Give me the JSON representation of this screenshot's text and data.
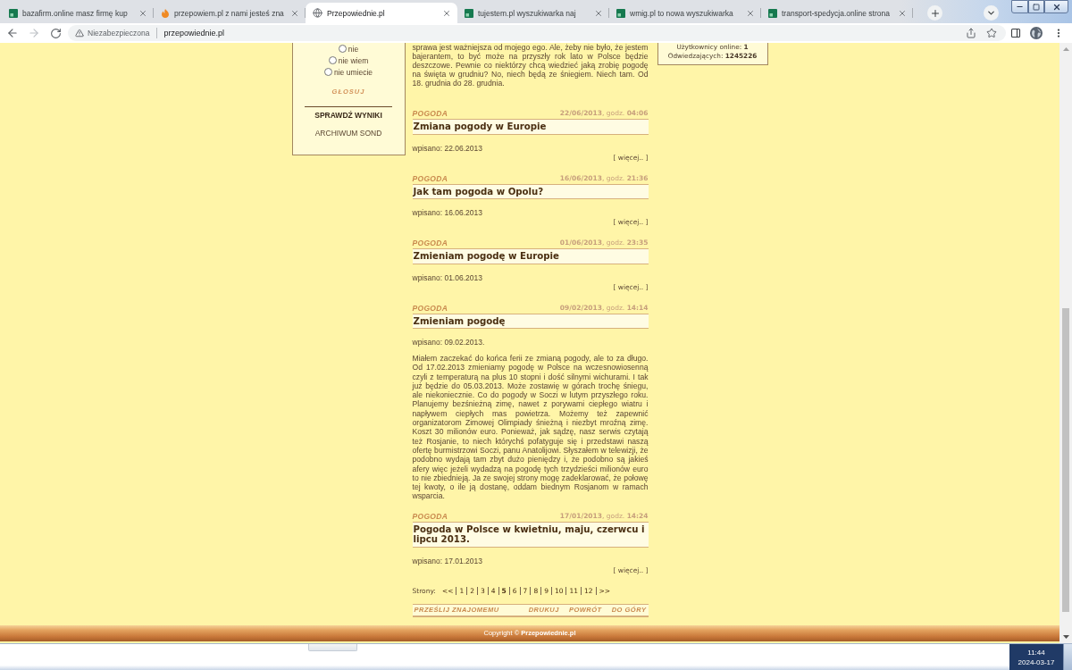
{
  "browser": {
    "tabs": [
      {
        "title": "bazafirm.online masz firmę kup",
        "kind": "tile",
        "selected": false
      },
      {
        "title": "przepowiem.pl z nami jesteś zna",
        "kind": "flame",
        "selected": false
      },
      {
        "title": "Przepowiednie.pl",
        "kind": "globe",
        "selected": true
      },
      {
        "title": "tujestem.pl wyszukiwarka naj",
        "kind": "tile",
        "selected": false
      },
      {
        "title": "wmig.pl to nowa wyszukiwarka",
        "kind": "tile",
        "selected": false
      },
      {
        "title": "transport-spedycja.online strona",
        "kind": "tile",
        "selected": false
      }
    ],
    "nav_buttons": [
      {
        "kind": "back",
        "disabled": false
      },
      {
        "kind": "forward",
        "disabled": true
      },
      {
        "kind": "reload",
        "disabled": false
      }
    ],
    "address_bar": {
      "security_label": "Niezabezpieczona",
      "url": "przepowiednie.pl"
    }
  },
  "page": {
    "poll": {
      "options": [
        {
          "label": "nie",
          "selected": false
        },
        {
          "label": "nie wiem",
          "selected": false
        },
        {
          "label": "nie umiecie",
          "selected": false
        }
      ],
      "vote_button": "GŁOSUJ",
      "results_link": "SPRAWDŹ WYNIKI",
      "archive_link": "ARCHIWUM SOND"
    },
    "intro_text": "sprawa jest ważniejsza od mojego ego. Ale, żeby nie było, że jestem bajerantem, to być może na przyszły rok lato w Polsce będzie deszczowe. Pewnie co niektórzy chcą wiedzieć jaką zrobię pogodę na święta w grudniu? No, niech będą ze śniegiem. Niech tam. Od 18. grudnia do 28. grudnia.",
    "stats": {
      "online": "Użytkownicy online: **1**",
      "visits": "Odwiedzających: **1245226**"
    },
    "articles": [
      {
        "category": "POGODA",
        "date": "**22/06/2013**, godz. **04:06**",
        "title": "Zmiana pogody w Europie",
        "posted": "wpisano: 22.06.2013",
        "more": "[ więcej.. ]"
      },
      {
        "category": "POGODA",
        "date": "**16/06/2013**, godz. **21:36**",
        "title": "Jak tam pogoda w Opolu?",
        "posted": "wpisano: 16.06.2013",
        "more": "[ więcej.. ]"
      },
      {
        "category": "POGODA",
        "date": "**01/06/2013**, godz. **23:35**",
        "title": "Zmieniam pogodę w Europie",
        "posted": "wpisano: 01.06.2013",
        "more": "[ więcej.. ]"
      },
      {
        "category": "POGODA",
        "date": "**09/02/2013**, godz. **14:14**",
        "title": "Zmieniam pogodę",
        "posted": "wpisano: 09.02.2013.",
        "body": "Miałem zaczekać do końca ferii ze zmianą pogody, ale to za długo. Od 17.02.2013 zmieniamy pogodę w Polsce na wczesnowiosenną czyli z temperaturą na plus 10 stopni i dość silnymi wichurami. I tak już będzie do 05.03.2013. Może zostawię w górach trochę śniegu, ale niekoniecznie. Co do pogody w Soczi w lutym przyszłego roku. Planujemy bezśnieżną zimę, nawet z porywami ciepłego wiatru i napływem ciepłych mas powietrza. Możemy też zapewnić organizatorom Zimowej Olimpiady śnieżną i niezbyt mroźną zimę. Koszt 30 milionów euro. Ponieważ, jak sądzę, nasz serwis czytają też Rosjanie, to niech którychś pofatyguje się i przedstawi naszą ofertę burmistrzowi Soczi, panu Anatolijowi. Słyszałem w telewizji, że podobno wydają tam zbyt dużo pieniędzy i, że podobno są jakieś afery więc jeżeli wydadzą na pogodę tych trzydzieści milionów euro to nie zbiednieją. Ja ze swojej strony mogę zadeklarować, że połowę tej kwoty, o ile ją dostanę, oddam biednym Rosjanom w ramach wsparcia."
      },
      {
        "category": "POGODA",
        "date": "**17/01/2013**, godz. **14:24**",
        "title": "Pogoda w Polsce w kwietniu, maju, czerwcu i lipcu 2013.",
        "posted": "wpisano: 17.01.2013",
        "more": "[ więcej.. ]"
      }
    ],
    "pagination": {
      "label": "Strony:",
      "prev": "<<",
      "pages": [
        {
          "label": "1",
          "selected": false
        },
        {
          "label": "2",
          "selected": false
        },
        {
          "label": "3",
          "selected": false
        },
        {
          "label": "4",
          "selected": false
        },
        {
          "label": "5",
          "selected": true
        },
        {
          "label": "6",
          "selected": false
        },
        {
          "label": "7",
          "selected": false
        },
        {
          "label": "8",
          "selected": false
        },
        {
          "label": "9",
          "selected": false
        },
        {
          "label": "10",
          "selected": false
        },
        {
          "label": "11",
          "selected": false
        },
        {
          "label": "12",
          "selected": false
        }
      ],
      "next": ">>"
    },
    "actions": {
      "share": "PRZEŚLIJ ZNAJOMEMU",
      "print": "DRUKUJ",
      "back": "POWRÓT",
      "top": "DO GÓRY"
    },
    "footer": {
      "copyright": "Copyright © **Przepowiednie.pl**"
    }
  },
  "taskbar": {
    "time": "11:44",
    "date": "2024-03-17"
  }
}
